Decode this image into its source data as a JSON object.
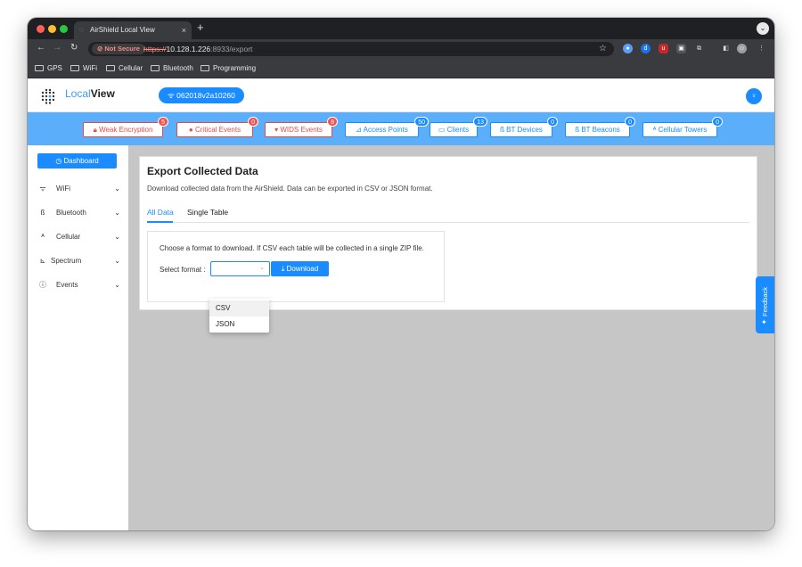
{
  "browser": {
    "tab_title": "AirShield Local View",
    "tab_close": "×",
    "new_tab": "+",
    "not_secure": "Not Secure",
    "url_scheme": "https://",
    "url_host": "10.128.1.226",
    "url_path": ":8933/export",
    "bookmarks": [
      "GPS",
      "WiFi",
      "Cellular",
      "Bluetooth",
      "Programming"
    ]
  },
  "app": {
    "brand_local": "Local",
    "brand_view": "View",
    "device_id": "062018v2a10260"
  },
  "alerts": [
    {
      "label": "Weak Encryption",
      "count": "5",
      "color": "red"
    },
    {
      "label": "Critical Events",
      "count": "0",
      "color": "red"
    },
    {
      "label": "WIDS Events",
      "count": "8",
      "color": "red"
    },
    {
      "label": "Access Points",
      "count": "50",
      "color": "blue"
    },
    {
      "label": "Clients",
      "count": "13",
      "color": "blue"
    },
    {
      "label": "BT Devices",
      "count": "0",
      "color": "blue"
    },
    {
      "label": "BT Beacons",
      "count": "0",
      "color": "blue"
    },
    {
      "label": "Cellular Towers",
      "count": "0",
      "color": "blue"
    }
  ],
  "sidebar": {
    "dashboard": "Dashboard",
    "items": [
      {
        "label": "WiFi",
        "icon": "wifi-icon"
      },
      {
        "label": "Bluetooth",
        "icon": "bluetooth-icon"
      },
      {
        "label": "Cellular",
        "icon": "cell-tower-icon"
      },
      {
        "label": "Spectrum",
        "icon": "chart-icon"
      },
      {
        "label": "Events",
        "icon": "info-icon"
      }
    ]
  },
  "main": {
    "title": "Export Collected Data",
    "description": "Download collected data from the AirShield. Data can be exported in CSV or JSON format.",
    "tabs": [
      "All Data",
      "Single Table"
    ],
    "instructions": "Choose a format to download. If CSV each table will be collected in a single ZIP file.",
    "select_label": "Select format :",
    "download_label": "Download",
    "options": [
      "CSV",
      "JSON"
    ]
  },
  "feedback": "Feedback",
  "colors": {
    "accent": "#1a8cff",
    "alert_bar": "#5aaefa",
    "danger": "#e34b4b"
  }
}
